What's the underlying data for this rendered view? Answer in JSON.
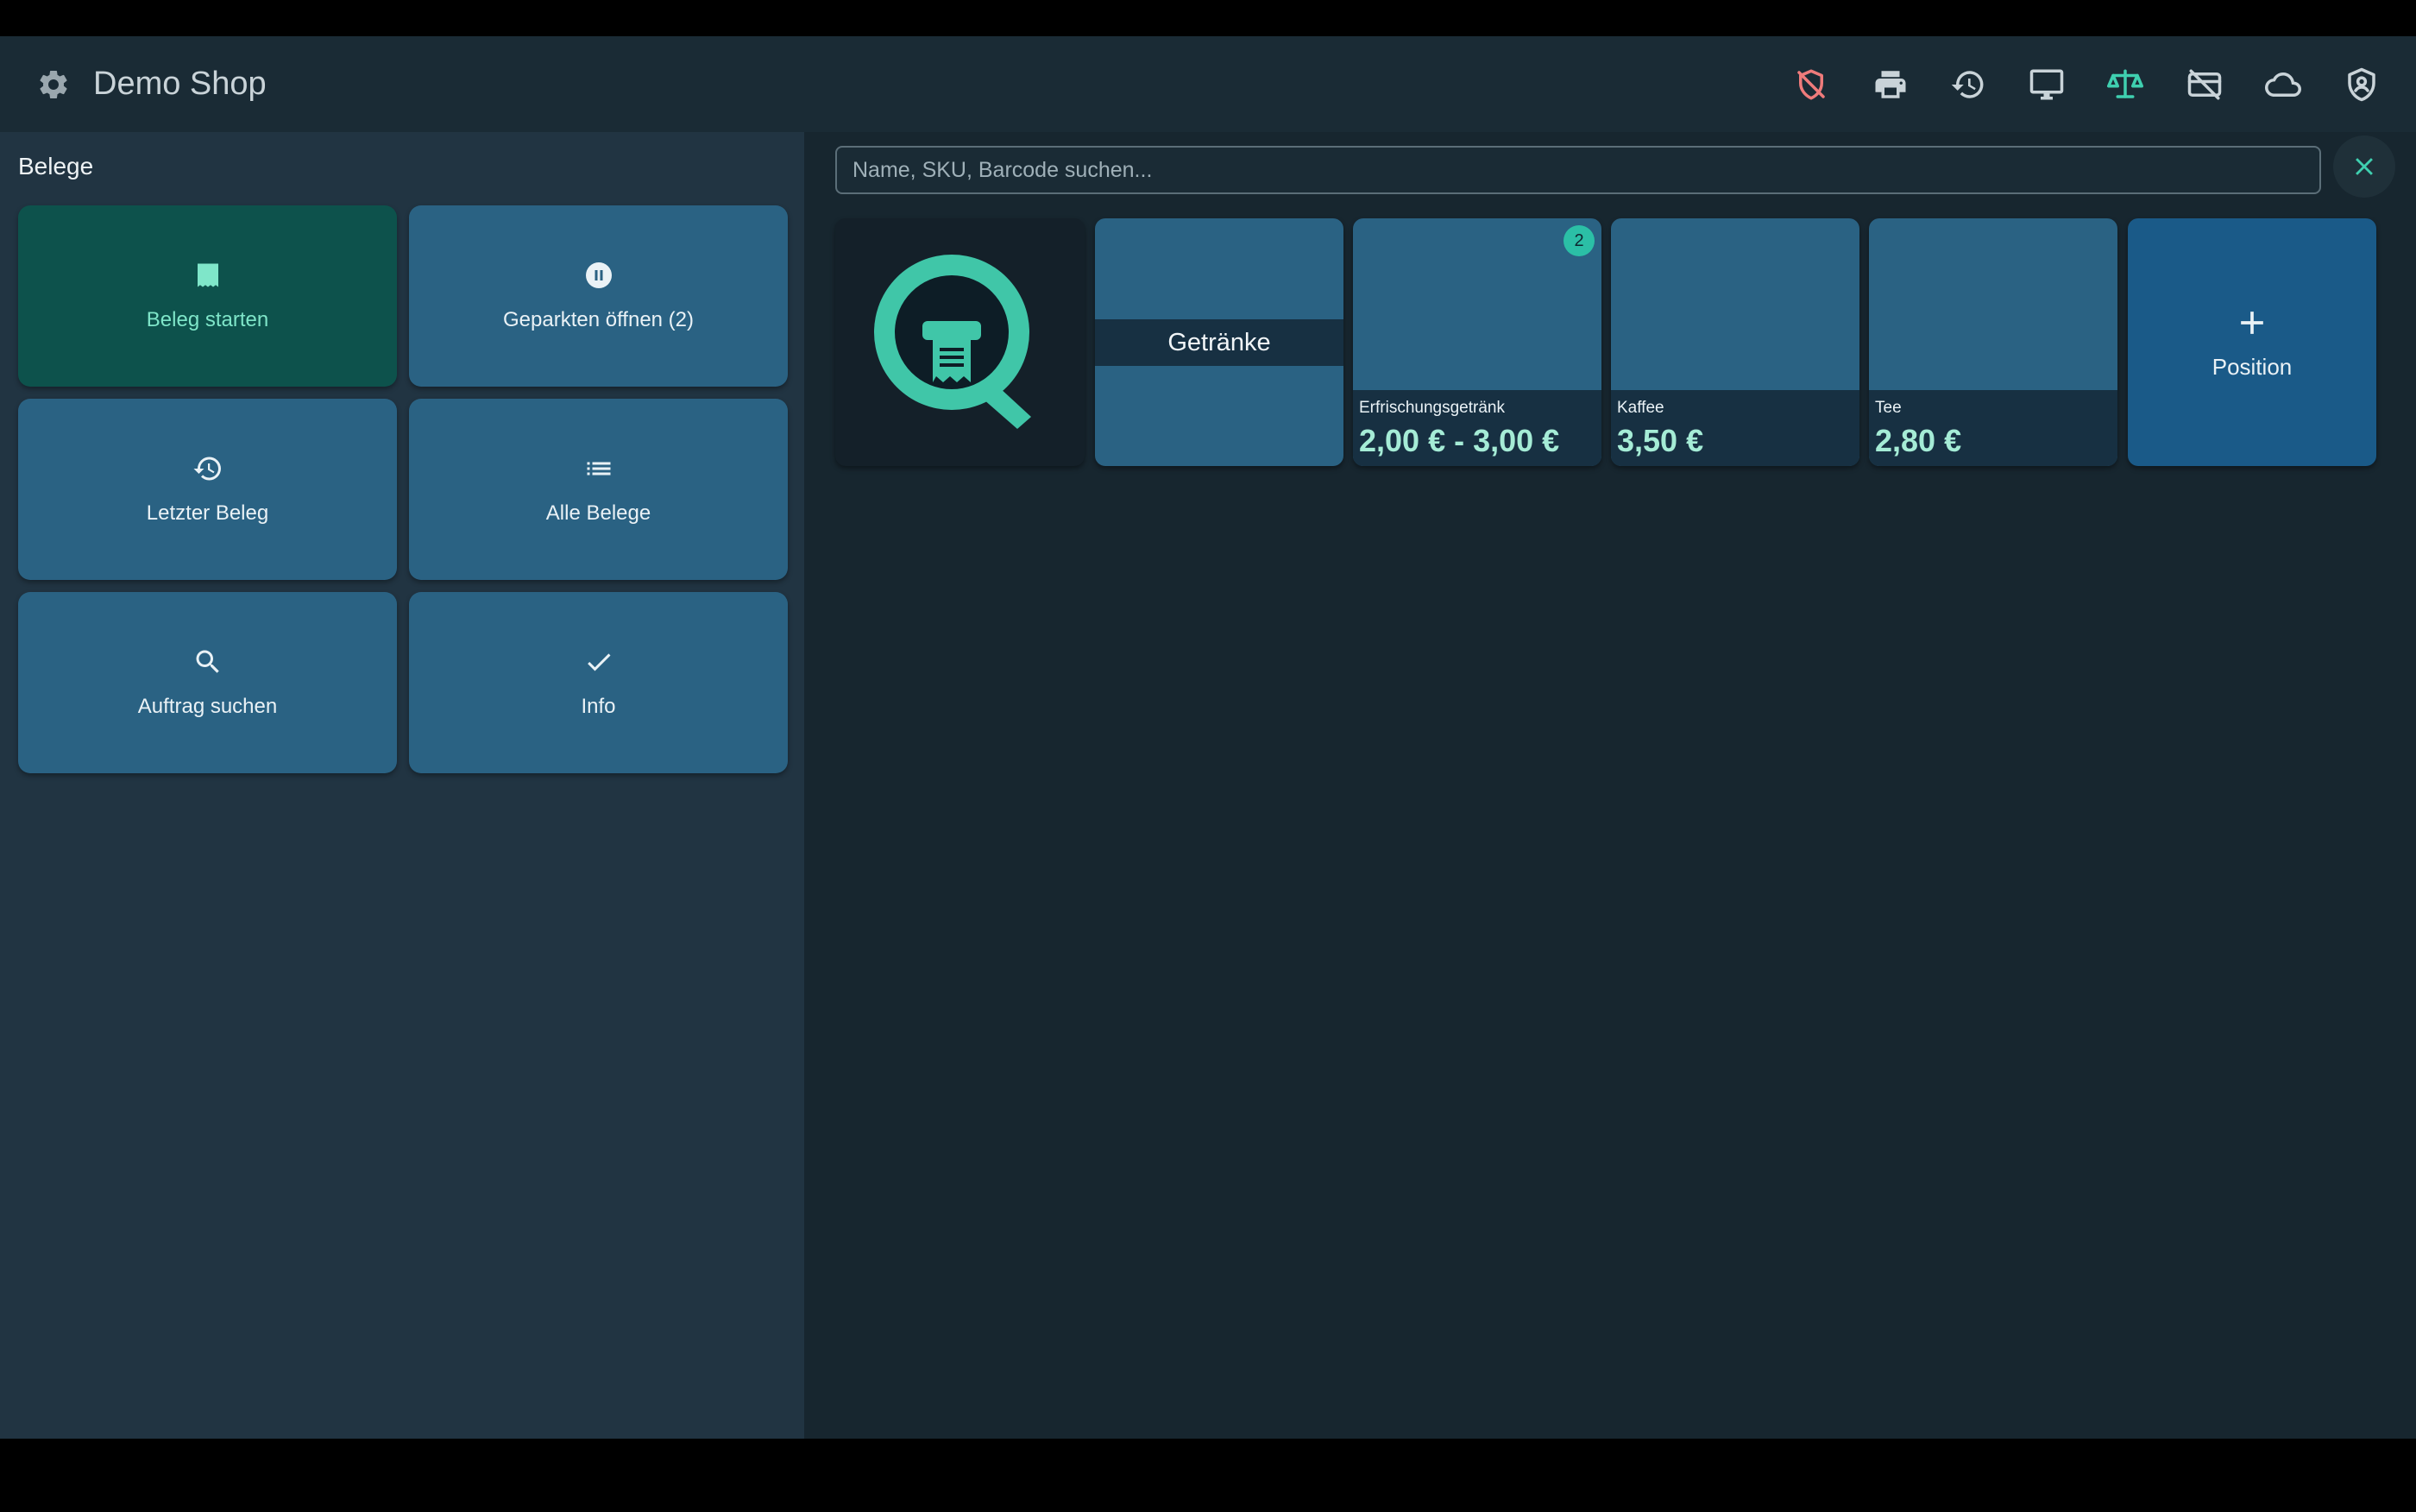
{
  "header": {
    "title": "Demo Shop",
    "icons": [
      {
        "name": "shield-off-icon",
        "color": "#ef7b7b"
      },
      {
        "name": "printer-icon",
        "color": "#c9d3d8"
      },
      {
        "name": "history-icon",
        "color": "#c9d3d8"
      },
      {
        "name": "monitor-icon",
        "color": "#c9d3d8"
      },
      {
        "name": "scale-icon",
        "color": "#3fd0b0"
      },
      {
        "name": "card-off-icon",
        "color": "#c9d3d8"
      },
      {
        "name": "cloud-icon",
        "color": "#c9d3d8"
      },
      {
        "name": "shield-user-icon",
        "color": "#c9d3d8"
      }
    ]
  },
  "sidebar": {
    "title": "Belege",
    "tiles": [
      {
        "label": "Beleg starten",
        "icon": "receipt-icon"
      },
      {
        "label": "Geparkten öffnen (2)",
        "icon": "pause-icon"
      },
      {
        "label": "Letzter Beleg",
        "icon": "history-icon"
      },
      {
        "label": "Alle Belege",
        "icon": "list-icon"
      },
      {
        "label": "Auftrag suchen",
        "icon": "search-icon"
      },
      {
        "label": "Info",
        "icon": "check-icon"
      }
    ]
  },
  "search": {
    "placeholder": "Name, SKU, Barcode suchen...",
    "value": ""
  },
  "grid": {
    "category": "Getränke",
    "products": [
      {
        "name": "Erfrischungsgetränk",
        "price": "2,00 € - 3,00 €",
        "badge": "2"
      },
      {
        "name": "Kaffee",
        "price": "3,50 €"
      },
      {
        "name": "Tee",
        "price": "2,80 €"
      }
    ],
    "add_label": "Position"
  },
  "colors": {
    "accent": "#3fd0b0",
    "primary_tile": "#0d524c",
    "tile": "#2a6283"
  }
}
